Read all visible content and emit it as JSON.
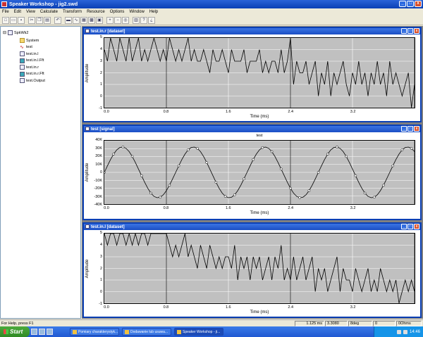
{
  "app": {
    "title": "Speaker Workshop - jig2.swd",
    "minimize": "_",
    "maximize": "□",
    "close": "x"
  },
  "menu": [
    "File",
    "Edit",
    "View",
    "Calculate",
    "Transform",
    "Resource",
    "Options",
    "Window",
    "Help"
  ],
  "toolbar": [
    "new-icon",
    "open-icon",
    "save-icon",
    "sep",
    "cut-icon",
    "copy-icon",
    "paste-icon",
    "sep",
    "undo-icon",
    "sep",
    "folder-icon",
    "signal-icon",
    "chart-icon",
    "grid-icon",
    "view-icon",
    "sep",
    "zoom-in-icon",
    "zoom-out-icon",
    "zoom-fit-icon",
    "sep",
    "print-icon",
    "help-icon",
    "whats-this-icon"
  ],
  "tree": {
    "root": "SpkWk2",
    "items": [
      {
        "label": "System",
        "icon": "folder-icon"
      },
      {
        "label": "test",
        "icon": "wave-icon"
      },
      {
        "label": "test.in.l",
        "icon": "dataset-icon"
      },
      {
        "label": "test.in.l.Fft",
        "icon": "fft-icon"
      },
      {
        "label": "test.in.r",
        "icon": "dataset-icon"
      },
      {
        "label": "test.in.r.Fft",
        "icon": "fft-icon"
      },
      {
        "label": "test.Output",
        "icon": "dataset-icon"
      }
    ]
  },
  "windows": [
    {
      "title": "test.in.r [dataset]",
      "ylabel": "Amplitude",
      "xlabel": "Time (ms)",
      "plot_title": "",
      "yticks": [
        "5",
        "4",
        "3",
        "2",
        "1",
        "0",
        "-1"
      ],
      "xticks": [
        "0.0",
        "0.8",
        "1.6",
        "2.4",
        "3.2"
      ]
    },
    {
      "title": "test [signal]",
      "ylabel": "Amplitude",
      "xlabel": "Time (ms)",
      "plot_title": "test",
      "yticks": [
        "40K",
        "30K",
        "20K",
        "10K",
        "0",
        "-10K",
        "-20K",
        "-30K",
        "-40K"
      ],
      "xticks": [
        "0.0",
        "0.8",
        "1.6",
        "2.4",
        "3.2"
      ]
    },
    {
      "title": "test.in.l [dataset]",
      "ylabel": "Amplitude",
      "xlabel": "Time (ms)",
      "plot_title": "",
      "yticks": [
        "5",
        "4",
        "3",
        "2",
        "1",
        "0",
        "-1"
      ],
      "xticks": [
        "0.0",
        "0.8",
        "1.6",
        "2.4",
        "3.2"
      ]
    }
  ],
  "chart_data": [
    {
      "type": "line",
      "title": "",
      "xlabel": "Time (ms)",
      "ylabel": "Amplitude",
      "xlim": [
        0,
        4.0
      ],
      "ylim": [
        -1,
        5
      ],
      "grid": true,
      "series": [
        {
          "x": [
            0.0,
            0.04,
            0.08,
            0.12,
            0.16,
            0.2,
            0.24,
            0.28,
            0.32,
            0.36,
            0.4,
            0.44,
            0.48,
            0.52,
            0.56,
            0.6,
            0.64,
            0.68,
            0.72,
            0.76,
            0.8,
            0.84,
            0.88,
            0.92,
            0.96,
            1.0,
            1.04,
            1.08,
            1.12,
            1.16,
            1.2,
            1.24,
            1.28,
            1.32,
            1.36,
            1.4,
            1.44,
            1.48,
            1.52,
            1.56,
            1.6,
            1.64,
            1.68,
            1.72,
            1.76,
            1.8,
            1.84,
            1.88,
            1.92,
            1.96,
            2.0,
            2.04,
            2.08,
            2.12,
            2.16,
            2.2,
            2.24,
            2.28,
            2.32,
            2.36,
            2.4,
            2.44,
            2.48,
            2.52,
            2.56,
            2.6,
            2.64,
            2.68,
            2.72,
            2.76,
            2.8,
            2.84,
            2.88,
            2.92,
            2.96,
            3.0,
            3.04,
            3.08,
            3.12,
            3.16,
            3.2,
            3.24,
            3.28,
            3.32,
            3.36,
            3.4,
            3.44,
            3.48,
            3.52,
            3.56,
            3.6,
            3.64,
            3.68,
            3.72,
            3.76,
            3.8,
            3.84,
            3.88,
            3.92,
            3.96,
            4.0
          ],
          "y": [
            4,
            3,
            5,
            4,
            3,
            5,
            4,
            3,
            5,
            3,
            4,
            5,
            3,
            4,
            3,
            4,
            5,
            4,
            3,
            4,
            3,
            5,
            4,
            3,
            4,
            3,
            4,
            5,
            3,
            4,
            3,
            3,
            4,
            3,
            2,
            4,
            3,
            3,
            4,
            3,
            2,
            4,
            3,
            3,
            3,
            4,
            2,
            3,
            3,
            3,
            4,
            2,
            3,
            2,
            3,
            3,
            2,
            4,
            2,
            3,
            5,
            1,
            3,
            2,
            2,
            3,
            1,
            2,
            3,
            0,
            2,
            1,
            3,
            0,
            2,
            1,
            2,
            3,
            1,
            0,
            2,
            1,
            3,
            1,
            2,
            0,
            2,
            1,
            3,
            1,
            2,
            0,
            3,
            1,
            2,
            1,
            0,
            1,
            2,
            -1,
            1
          ]
        }
      ]
    },
    {
      "type": "line",
      "title": "test",
      "xlabel": "Time (ms)",
      "ylabel": "Amplitude",
      "xlim": [
        0,
        4.0
      ],
      "ylim": [
        -40000,
        40000
      ],
      "grid": true,
      "series": [
        {
          "name": "test",
          "x": [
            0.0,
            0.04,
            0.08,
            0.12,
            0.16,
            0.2,
            0.24,
            0.28,
            0.32,
            0.36,
            0.4,
            0.44,
            0.48,
            0.52,
            0.56,
            0.6,
            0.64,
            0.68,
            0.72,
            0.76,
            0.8,
            0.84,
            0.88,
            0.92,
            0.96,
            1.0,
            1.04,
            1.08,
            1.12,
            1.16,
            1.2,
            1.24,
            1.28,
            1.32,
            1.36,
            1.4,
            1.44,
            1.48,
            1.52,
            1.56,
            1.6,
            1.64,
            1.68,
            1.72,
            1.76,
            1.8,
            1.84,
            1.88,
            1.92,
            1.96,
            2.0,
            2.04,
            2.08,
            2.12,
            2.16,
            2.2,
            2.24,
            2.28,
            2.32,
            2.36,
            2.4,
            2.44,
            2.48,
            2.52,
            2.56,
            2.6,
            2.64,
            2.68,
            2.72,
            2.76,
            2.8,
            2.84,
            2.88,
            2.92,
            2.96,
            3.0,
            3.04,
            3.08,
            3.12,
            3.16,
            3.2,
            3.24,
            3.28,
            3.32,
            3.36,
            3.4,
            3.44,
            3.48,
            3.52,
            3.56,
            3.6,
            3.64,
            3.68,
            3.72,
            3.76,
            3.8,
            3.84,
            3.88,
            3.92,
            3.96,
            4.0
          ],
          "y": [
            0,
            8300,
            16300,
            23100,
            28400,
            31400,
            32000,
            30300,
            26200,
            20100,
            12500,
            4200,
            -4200,
            -12500,
            -20100,
            -26200,
            -30300,
            -32000,
            -31400,
            -28400,
            -23100,
            -16300,
            -8300,
            0,
            8300,
            16300,
            23100,
            28400,
            31400,
            32000,
            30300,
            26200,
            20100,
            12500,
            4200,
            -4200,
            -12500,
            -20100,
            -26200,
            -30300,
            -32000,
            -31400,
            -28400,
            -23100,
            -16300,
            -8300,
            0,
            8300,
            16300,
            23100,
            28400,
            31400,
            32000,
            30300,
            26200,
            20100,
            12500,
            4200,
            -4200,
            -12500,
            -20100,
            -26200,
            -30300,
            -32000,
            -31400,
            -28400,
            -23100,
            -16300,
            -8300,
            0,
            8300,
            16300,
            23100,
            28400,
            31400,
            32000,
            30300,
            26200,
            20100,
            12500,
            4200,
            -4200,
            -12500,
            -20100,
            -26200,
            -30300,
            -32000,
            -31400,
            -28400,
            -23100,
            -16300,
            -8300,
            0,
            8300,
            16300,
            23100,
            28400,
            31400,
            32000,
            30300,
            26200
          ]
        }
      ]
    },
    {
      "type": "line",
      "title": "",
      "xlabel": "Time (ms)",
      "ylabel": "Amplitude",
      "xlim": [
        0,
        4.0
      ],
      "ylim": [
        -1,
        5
      ],
      "grid": true,
      "series": [
        {
          "x": [
            0.0,
            0.04,
            0.08,
            0.12,
            0.16,
            0.2,
            0.24,
            0.28,
            0.32,
            0.36,
            0.4,
            0.44,
            0.48,
            0.52,
            0.56,
            0.6,
            0.64,
            0.68,
            0.72,
            0.76,
            0.8,
            0.84,
            0.88,
            0.92,
            0.96,
            1.0,
            1.04,
            1.08,
            1.12,
            1.16,
            1.2,
            1.24,
            1.28,
            1.32,
            1.36,
            1.4,
            1.44,
            1.48,
            1.52,
            1.56,
            1.6,
            1.64,
            1.68,
            1.72,
            1.76,
            1.8,
            1.84,
            1.88,
            1.92,
            1.96,
            2.0,
            2.04,
            2.08,
            2.12,
            2.16,
            2.2,
            2.24,
            2.28,
            2.32,
            2.36,
            2.4,
            2.44,
            2.48,
            2.52,
            2.56,
            2.6,
            2.64,
            2.68,
            2.72,
            2.76,
            2.8,
            2.84,
            2.88,
            2.92,
            2.96,
            3.0,
            3.04,
            3.08,
            3.12,
            3.16,
            3.2,
            3.24,
            3.28,
            3.32,
            3.36,
            3.4,
            3.44,
            3.48,
            3.52,
            3.56,
            3.6,
            3.64,
            3.68,
            3.72,
            3.76,
            3.8,
            3.84,
            3.88,
            3.92,
            3.96,
            4.0
          ],
          "y": [
            5,
            4,
            5,
            5,
            4,
            5,
            5,
            4,
            5,
            4,
            5,
            4,
            5,
            5,
            4,
            5,
            5,
            5,
            5,
            5,
            5,
            4,
            3,
            4,
            3,
            4,
            5,
            3,
            4,
            3,
            2,
            4,
            3,
            2,
            4,
            3,
            2,
            3,
            2,
            3,
            3,
            2,
            4,
            1,
            3,
            2,
            3,
            1,
            3,
            2,
            3,
            1,
            2,
            3,
            1,
            3,
            2,
            4,
            1,
            2,
            1,
            3,
            1,
            2,
            3,
            1,
            2,
            3,
            0,
            2,
            1,
            2,
            0,
            1,
            2,
            3,
            0,
            2,
            1,
            1,
            0,
            2,
            1,
            0,
            1,
            2,
            0,
            1,
            0,
            2,
            1,
            0,
            1,
            0,
            1,
            -1,
            0,
            1,
            0,
            1,
            0
          ]
        }
      ]
    }
  ],
  "status": {
    "help": "For Help, press F1",
    "time": "1.125 ms",
    "value": "3.3080",
    "phase": "8deg",
    "zero": "0",
    "ohms": "0Ohms"
  },
  "taskbar": {
    "start": "Start",
    "tasks": [
      "Pomiary charakterystyk...",
      "Dodawanie lub usuwa...",
      "Speaker Workshop - ji..."
    ],
    "clock": "14:46"
  }
}
